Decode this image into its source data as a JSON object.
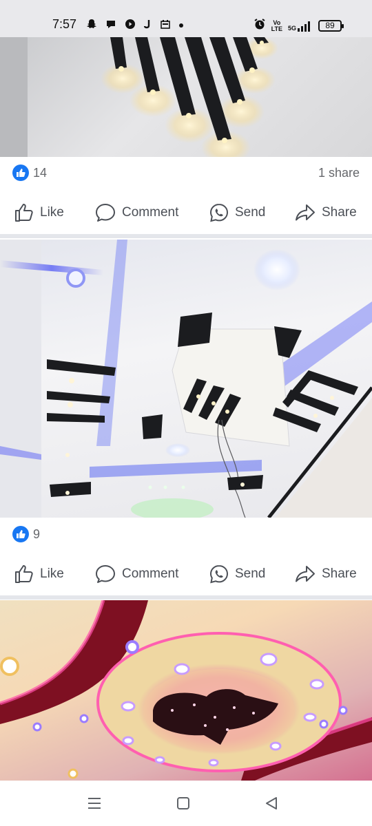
{
  "status_bar": {
    "time": "7:57",
    "left_icons": [
      "snapchat-icon",
      "chat-bubble-icon",
      "play-icon",
      "j-app-icon",
      "calendar-app-icon",
      "dot-icon"
    ],
    "network_top": "Vo",
    "network_bottom": "LTE",
    "signal_label": "5G",
    "battery": "89"
  },
  "posts": [
    {
      "image_alt": "ceiling with black angled light bars",
      "likes": "14",
      "shares": "1 share"
    },
    {
      "image_alt": "white false ceiling with blue led and black accents",
      "likes": "9",
      "shares": ""
    },
    {
      "image_alt": "circular false ceiling with pink led and heart shape"
    }
  ],
  "actions": {
    "like": "Like",
    "comment": "Comment",
    "send": "Send",
    "share": "Share"
  },
  "nav_bar": {
    "buttons": [
      "menu-icon",
      "home-icon",
      "back-icon"
    ]
  }
}
